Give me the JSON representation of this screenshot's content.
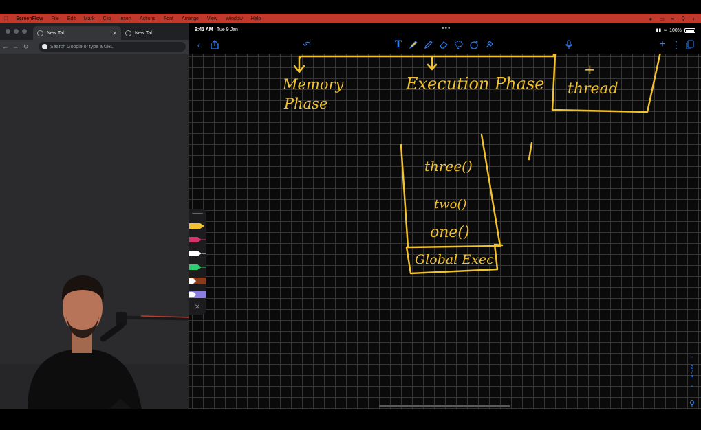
{
  "menubar": {
    "app_name": "ScreenFlow",
    "items": [
      "File",
      "Edit",
      "Mark",
      "Clip",
      "Insert",
      "Actions",
      "Font",
      "Arrange",
      "View",
      "Window",
      "Help"
    ]
  },
  "browser": {
    "tabs": [
      {
        "label": "New Tab",
        "active": true
      },
      {
        "label": "New Tab",
        "active": false
      }
    ],
    "omnibox_placeholder": "Search Google or type a URL"
  },
  "ipad": {
    "status": {
      "time": "9:41 AM",
      "date": "Tue 9 Jan",
      "battery": "100%"
    },
    "toolbar_icons": [
      "back-icon",
      "share-icon",
      "undo-icon",
      "text-tool-icon",
      "highlighter-icon",
      "pen-icon",
      "eraser-icon",
      "lasso-icon",
      "shapes-icon",
      "laser-pointer-icon",
      "microphone-icon",
      "add-page-icon",
      "more-icon",
      "pages-icon"
    ],
    "accent_color": "#2f7ff5",
    "ink_color": "#f2c12e",
    "pen_colors": [
      "#f2c12e",
      "#d6336c",
      "#ffffff",
      "#2ecc71",
      "#8b3a1a",
      "#8a7fe0"
    ],
    "page_indicator": {
      "current": "2",
      "separator": "/",
      "total": "3"
    },
    "handwriting": {
      "memory_phase": [
        "Memory",
        "Phase"
      ],
      "execution_phase": "Execution Phase",
      "thread_plus": "+",
      "thread": "thread",
      "stack": [
        "three()",
        "two()",
        "one()"
      ],
      "global_exec": "Global Exec"
    }
  }
}
